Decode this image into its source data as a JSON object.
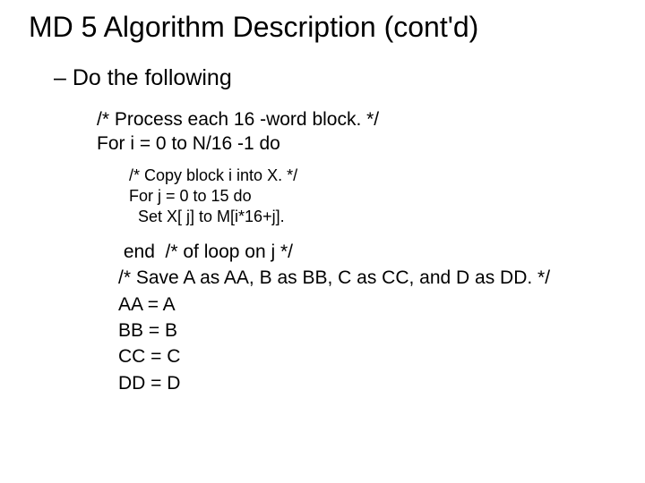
{
  "title": "MD 5 Algorithm Description (cont'd)",
  "subheading": "– Do the following",
  "block1": {
    "line1": "/* Process each 16 -word block. */",
    "line2": "For i = 0 to N/16 -1 do"
  },
  "block2": {
    "line1": "/* Copy block i into X. */",
    "line2": "For j = 0 to 15 do",
    "line3": "  Set X[ j] to M[i*16+j]."
  },
  "block3": {
    "line1": " end  /* of loop on j */",
    "line2": "/* Save A as AA, B as BB, C as CC, and D as DD. */",
    "line3": "AA = A",
    "line4": "BB = B",
    "line5": "CC = C",
    "line6": "DD = D"
  }
}
